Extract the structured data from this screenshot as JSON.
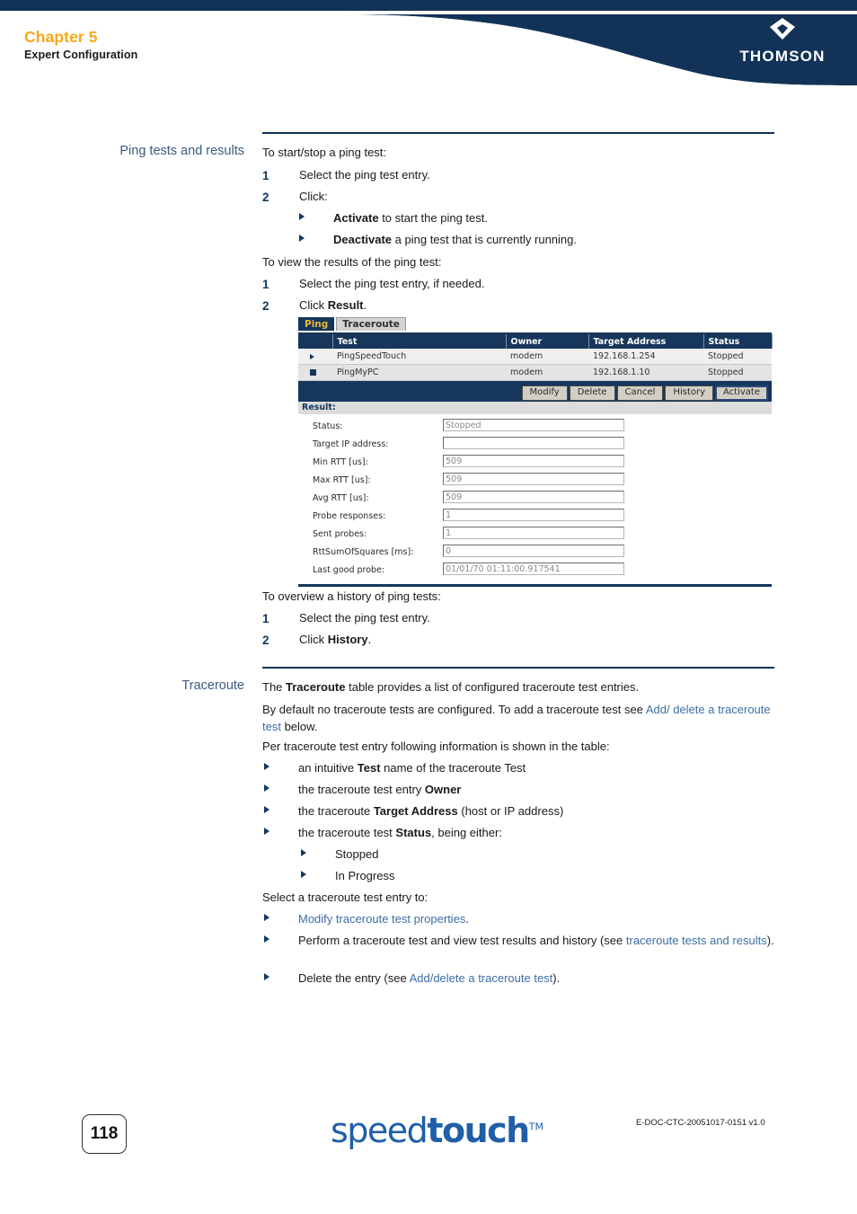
{
  "header": {
    "chapter": "Chapter 5",
    "subtitle": "Expert Configuration",
    "brand": "THOMSON"
  },
  "sections": {
    "ping": {
      "margin_label": "Ping tests and results",
      "intro_start_stop": "To start/stop a ping test:",
      "step1_num": "1",
      "step1_text": "Select the ping test entry.",
      "step2_num": "2",
      "step2_text": "Click:",
      "bullet_activate_bold": "Activate",
      "bullet_activate_rest": " to start the ping test.",
      "bullet_deactivate_bold": "Deactivate",
      "bullet_deactivate_rest": " a ping test that is currently running.",
      "intro_view_results": "To view the results of the ping test:",
      "view1_num": "1",
      "view1_text": "Select the ping test entry, if needed.",
      "view2_num": "2",
      "view2_text_pre": "Click ",
      "view2_text_bold": "Result",
      "view2_text_post": ".",
      "intro_history": "To overview a history of ping tests:",
      "hist1_num": "1",
      "hist1_text": "Select the ping test entry.",
      "hist2_num": "2",
      "hist2_text_pre": "Click ",
      "hist2_text_bold": "History",
      "hist2_text_post": "."
    },
    "traceroute": {
      "margin_label": "Traceroute",
      "p1_pre": "The ",
      "p1_bold": "Traceroute",
      "p1_post": " table provides a list of configured traceroute test entries.",
      "p2_pre": "By default no traceroute tests are configured. To add a traceroute test see ",
      "p2_link": "Add/ delete a traceroute test",
      "p2_post": " below.",
      "p3": "Per traceroute test entry following information is shown in the table:",
      "item1_pre": "an intuitive ",
      "item1_bold": "Test",
      "item1_post": " name of the traceroute Test",
      "item2_pre": "the traceroute test entry ",
      "item2_bold": "Owner",
      "item2_post": "",
      "item3_pre": "the traceroute ",
      "item3_bold": "Target Address",
      "item3_post": " (host or IP address)",
      "item4_pre": "the traceroute test ",
      "item4_bold": "Status",
      "item4_post": ", being either:",
      "sub1": "Stopped",
      "sub2": "In Progress",
      "p4": "Select a traceroute test entry to:",
      "act1_link": "Modify traceroute test properties",
      "act1_post": ".",
      "act2_pre": "Perform a traceroute test and view test results and history (see ",
      "act2_link": "traceroute tests and results",
      "act2_post": ").",
      "act3_pre": "Delete the entry (see ",
      "act3_link": "Add/delete a traceroute test",
      "act3_post": ")."
    }
  },
  "widget": {
    "tabs": [
      {
        "label": "Ping",
        "active": true
      },
      {
        "label": "Traceroute",
        "active": false
      }
    ],
    "table": {
      "columns": [
        "",
        "Test",
        "Owner",
        "Target Address",
        "Status"
      ],
      "rows": [
        {
          "marker": "arrow",
          "test": "PingSpeedTouch",
          "owner": "modem",
          "target": "192.168.1.254",
          "status": "Stopped"
        },
        {
          "marker": "square",
          "test": "PingMyPC",
          "owner": "modem",
          "target": "192.168.1.10",
          "status": "Stopped"
        }
      ]
    },
    "buttons": [
      "Modify",
      "Delete",
      "Cancel",
      "History",
      "Activate"
    ],
    "result_header": "Result:",
    "fields": [
      {
        "label": "Status:",
        "value": "Stopped"
      },
      {
        "label": "Target IP address:",
        "value": ""
      },
      {
        "label": "Min RTT [us]:",
        "value": "509"
      },
      {
        "label": "Max RTT [us]:",
        "value": "509"
      },
      {
        "label": "Avg RTT [us]:",
        "value": "509"
      },
      {
        "label": "Probe responses:",
        "value": "1"
      },
      {
        "label": "Sent probes:",
        "value": "1"
      },
      {
        "label": "RttSumOfSquares [ms]:",
        "value": "0"
      },
      {
        "label": "Last good probe:",
        "value": "01/01/70 01:11:00.917541"
      }
    ]
  },
  "footer": {
    "page_number": "118",
    "brand_light": "speed",
    "brand_heavy": "touch",
    "brand_tm": "TM",
    "doc_id": "E-DOC-CTC-20051017-0151 v1.0"
  },
  "colors": {
    "navy": "#123357",
    "accent_orange": "#f5a81c",
    "link_blue": "#3c6fa5",
    "margin_label_blue": "#3c5a82",
    "widget_navy": "#16365c",
    "tab_active_text": "#e8b93b"
  }
}
